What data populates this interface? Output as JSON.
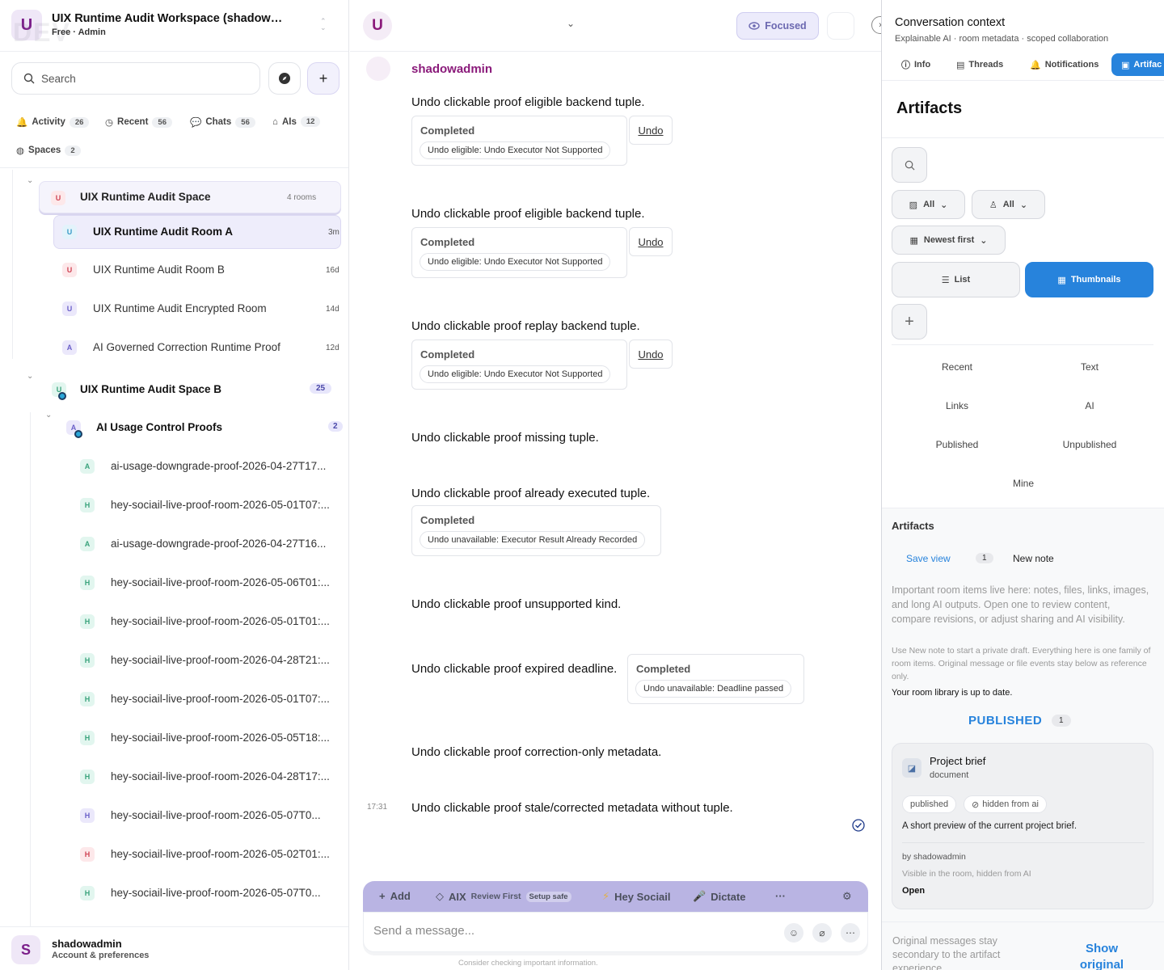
{
  "workspace": {
    "avatar_letter": "U",
    "watermark": "DEV",
    "name": "UIX Runtime Audit Workspace (shadow…",
    "plan": "Free · Admin",
    "sort_icon": "chevron-up-down-icon"
  },
  "search": {
    "placeholder": "Search",
    "add_label": "+"
  },
  "filters": [
    {
      "label": "Activity",
      "count": "26",
      "icon": "bell-icon"
    },
    {
      "label": "Recent",
      "count": "56",
      "icon": "clock-icon"
    },
    {
      "label": "Chats",
      "count": "56",
      "icon": "chat-icon"
    },
    {
      "label": "AIs",
      "count": "12",
      "icon": "robot-icon"
    },
    {
      "label": "Spaces",
      "count": "2",
      "icon": "globe-icon"
    }
  ],
  "tree": {
    "space_a": {
      "avatar": "U",
      "label": "UIX Runtime Audit Space",
      "meta": "4 rooms"
    },
    "rooms_a": [
      {
        "avatar": "U",
        "label": "UIX Runtime Audit Room A",
        "meta": "3m"
      },
      {
        "avatar": "U",
        "label": "UIX Runtime Audit Room B",
        "meta": "16d"
      },
      {
        "avatar": "U",
        "label": "UIX Runtime Audit Encrypted Room",
        "meta": "14d"
      },
      {
        "avatar": "A",
        "label": "AI Governed Correction Runtime Proof",
        "meta": "12d"
      }
    ],
    "space_b": {
      "avatar": "U",
      "label": "UIX Runtime Audit Space B",
      "badge": "25"
    },
    "subspace": {
      "avatar": "A",
      "label": "AI Usage Control Proofs",
      "badge": "2"
    },
    "rooms_b": [
      {
        "avatar": "A",
        "label": "ai-usage-downgrade-proof-2026-04-27T17..."
      },
      {
        "avatar": "H",
        "label": "hey-sociail-live-proof-room-2026-05-01T07:..."
      },
      {
        "avatar": "A",
        "label": "ai-usage-downgrade-proof-2026-04-27T16..."
      },
      {
        "avatar": "H",
        "label": "hey-sociail-live-proof-room-2026-05-06T01:..."
      },
      {
        "avatar": "H",
        "label": "hey-sociail-live-proof-room-2026-05-01T01:..."
      },
      {
        "avatar": "H",
        "label": "hey-sociail-live-proof-room-2026-04-28T21:..."
      },
      {
        "avatar": "H",
        "label": "hey-sociail-live-proof-room-2026-05-01T07:..."
      },
      {
        "avatar": "H",
        "label": "hey-sociail-live-proof-room-2026-05-05T18:..."
      },
      {
        "avatar": "H",
        "label": "hey-sociail-live-proof-room-2026-04-28T17:..."
      },
      {
        "avatar": "H",
        "label": "hey-sociail-live-proof-room-2026-05-07T0..."
      },
      {
        "avatar": "H",
        "label": "hey-sociail-live-proof-room-2026-05-02T01:..."
      },
      {
        "avatar": "H",
        "label": "hey-sociail-live-proof-room-2026-05-07T0..."
      }
    ]
  },
  "user": {
    "avatar_letter": "S",
    "name": "shadowadmin",
    "sub": "Account & preferences"
  },
  "chat": {
    "header_avatar": "U",
    "focused_label": "Focused",
    "author": "shadowadmin",
    "messages": [
      {
        "text": "Undo clickable proof eligible backend tuple.",
        "card_title": "Completed",
        "card_pill": "Undo eligible: Undo Executor Not Supported",
        "undo": "Undo"
      },
      {
        "text": "Undo clickable proof eligible backend tuple.",
        "card_title": "Completed",
        "card_pill": "Undo eligible: Undo Executor Not Supported",
        "undo": "Undo"
      },
      {
        "text": "Undo clickable proof replay backend tuple.",
        "card_title": "Completed",
        "card_pill": "Undo eligible: Undo Executor Not Supported",
        "undo": "Undo"
      },
      {
        "text": "Undo clickable proof missing tuple."
      },
      {
        "text": "Undo clickable proof already executed tuple.",
        "card_title": "Completed",
        "card_pill": "Undo unavailable: Executor Result Already Recorded"
      },
      {
        "text": "Undo clickable proof unsupported kind."
      },
      {
        "text": "Undo clickable proof expired deadline.",
        "card_title": "Completed",
        "card_pill": "Undo unavailable: Deadline passed"
      },
      {
        "text": "Undo clickable proof correction-only metadata."
      },
      {
        "text": "Undo clickable proof stale/corrected metadata without tuple."
      }
    ],
    "timestamp": "17:31"
  },
  "composer": {
    "add": "Add",
    "aix": "AIX",
    "review_first": "Review First",
    "setup_safe": "Setup safe",
    "hey": "Hey Sociail",
    "dictate": "Dictate",
    "more": "···",
    "placeholder": "Send a message...",
    "disclaimer": "Consider checking important information."
  },
  "context": {
    "title": "Conversation context",
    "subtitle": "Explainable AI · room metadata · scoped collaboration",
    "tabs": [
      {
        "label": "Info",
        "icon": "info-icon"
      },
      {
        "label": "Threads",
        "icon": "threads-icon"
      },
      {
        "label": "Notifications",
        "icon": "bell-icon"
      },
      {
        "label": "Artifac",
        "icon": "document-icon"
      }
    ]
  },
  "artifacts": {
    "title": "Artifacts",
    "filter_type": "All",
    "filter_owner": "All",
    "sort": "Newest first",
    "view_list": "List",
    "view_thumbnails": "Thumbnails",
    "chips": [
      "Recent",
      "Text",
      "Links",
      "AI",
      "Published",
      "Unpublished",
      "Mine"
    ],
    "section_title": "Artifacts",
    "save_view": "Save view",
    "count": "1",
    "new_note": "New note",
    "desc1": "Important room items live here: notes, files, links, images, and long AI outputs. Open one to review content, compare revisions, or adjust sharing and AI visibility.",
    "desc2": "Use New note to start a private draft. Everything here is one family of room items. Original message or file events stay below as reference only.",
    "up_to_date": "Your room library is up to date.",
    "published_heading": "PUBLISHED",
    "published_count": "1",
    "card": {
      "title": "Project brief",
      "type": "document",
      "pill_published": "published",
      "pill_hidden": "hidden from ai",
      "preview": "A short preview of the current project brief.",
      "by": "by shadowadmin",
      "visibility": "Visible in the room, hidden from AI",
      "open": "Open"
    },
    "original_text": "Original messages stay secondary to the artifact experience.",
    "show_original": "Show original"
  },
  "colors": {
    "accent": "#2783dc",
    "brand": "#8a1a7a",
    "composer_bar": "#b9b4e3"
  }
}
